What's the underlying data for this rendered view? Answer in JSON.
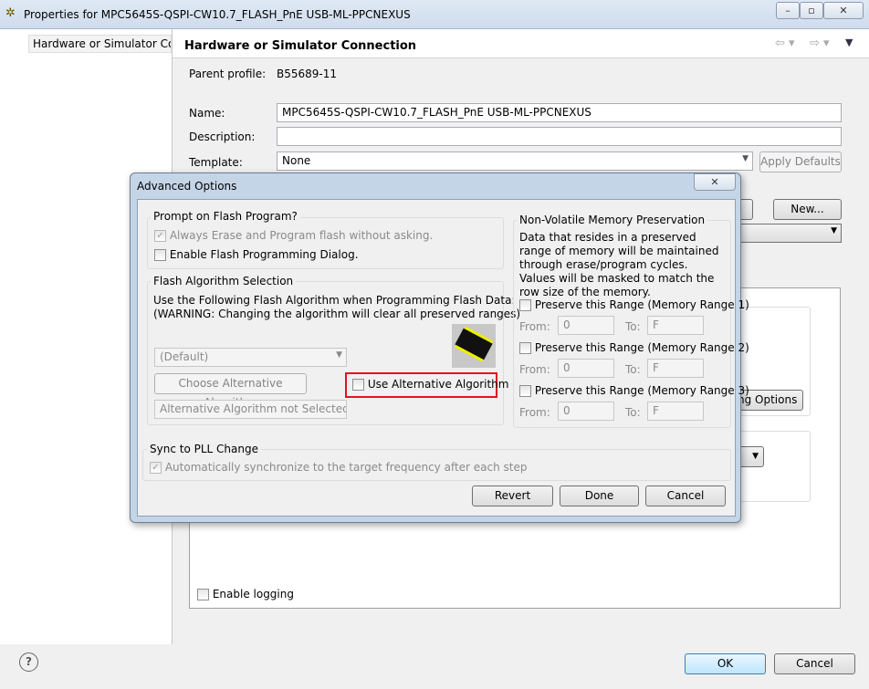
{
  "window": {
    "title": "Properties for MPC5645S-QSPI-CW10.7_FLASH_PnE USB-ML-PPCNEXUS",
    "icon": "codewarrior-icon"
  },
  "sidebar": {
    "items": [
      {
        "label": "Hardware or Simulator Conn"
      }
    ]
  },
  "page": {
    "title": "Hardware or Simulator Connection",
    "parent_profile_label": "Parent profile:",
    "parent_profile_value": "B55689-11",
    "name_label": "Name:",
    "name_value": "MPC5645S-QSPI-CW10.7_FLASH_PnE USB-ML-PPCNEXUS",
    "description_label": "Description:",
    "description_value": "",
    "template_label": "Template:",
    "template_value": "None",
    "apply_defaults": "Apply Defaults",
    "new_button": "New...",
    "options_button": "ing Options",
    "enable_logging": "Enable logging"
  },
  "footer": {
    "ok": "OK",
    "cancel": "Cancel"
  },
  "dialog": {
    "title": "Advanced Options",
    "prompt_group": {
      "title": "Prompt on Flash Program?",
      "always_erase": "Always Erase and Program flash without asking.",
      "always_erase_checked": true,
      "enable_dialog": "Enable Flash Programming Dialog.",
      "enable_dialog_checked": false
    },
    "algo_group": {
      "title": "Flash Algorithm Selection",
      "line1": "Use the Following Flash Algorithm when Programming Flash Data:",
      "line2": "(WARNING: Changing the algorithm will clear all preserved ranges)",
      "select_value": "(Default)",
      "choose_button": "Choose Alternative Algorithm",
      "status_field": "Alternative Algorithm not Selected",
      "use_alt": "Use Alternative Algorithm",
      "use_alt_checked": false,
      "highlight_color": "#e0141e"
    },
    "nvm_group": {
      "title": "Non-Volatile Memory Preservation",
      "desc": "Data that resides in a preserved range of memory will be maintained through erase/program cycles. Values will be masked to match the row size of the memory.",
      "ranges": [
        {
          "label": "Preserve this Range (Memory Range 1)",
          "from_label": "From:",
          "from": "0",
          "to_label": "To:",
          "to": "F"
        },
        {
          "label": "Preserve this Range (Memory Range 2)",
          "from_label": "From:",
          "from": "0",
          "to_label": "To:",
          "to": "F"
        },
        {
          "label": "Preserve this Range (Memory Range 3)",
          "from_label": "From:",
          "from": "0",
          "to_label": "To:",
          "to": "F"
        }
      ]
    },
    "pll_group": {
      "title": "Sync to PLL Change",
      "auto_sync": "Automatically synchronize to the target frequency after each step",
      "auto_sync_checked": true
    },
    "revert": "Revert",
    "done": "Done",
    "cancel": "Cancel"
  }
}
